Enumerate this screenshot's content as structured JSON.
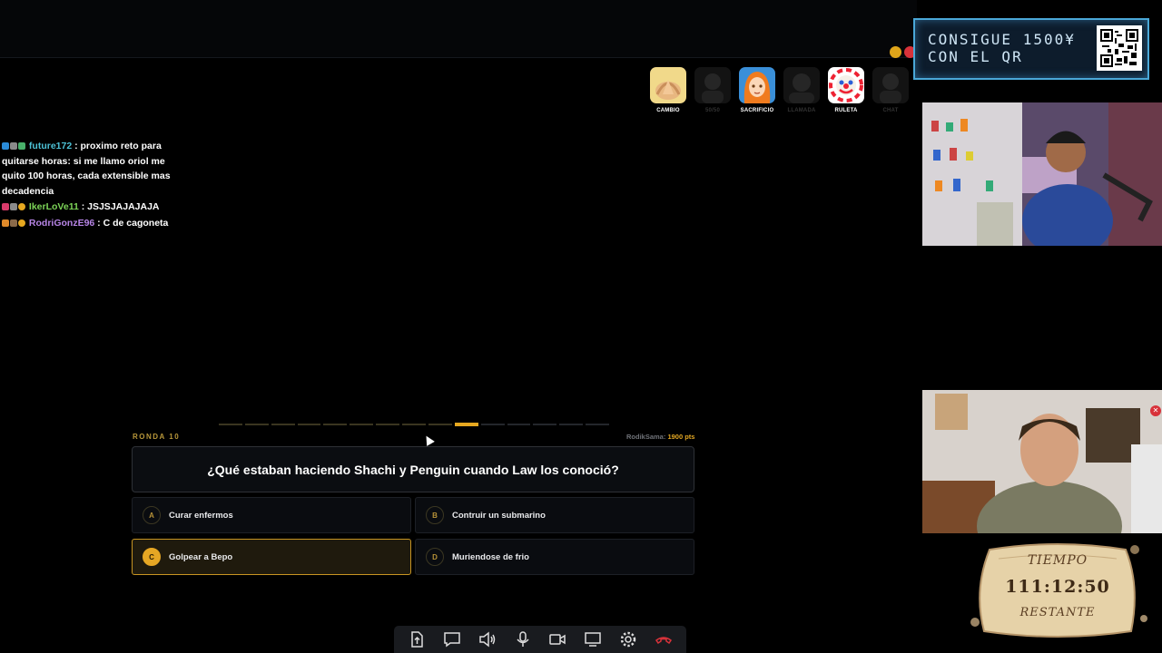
{
  "promo": {
    "line1": "CONSIGUE 1500¥",
    "line2": "CON EL QR"
  },
  "powerups": [
    {
      "label": "CAMBIO",
      "active": true,
      "icon": "praying-hands-icon"
    },
    {
      "label": "50/50",
      "active": false,
      "icon": "character-icon"
    },
    {
      "label": "SACRIFICIO",
      "active": true,
      "icon": "nami-icon"
    },
    {
      "label": "LLAMADA",
      "active": false,
      "icon": "character-icon"
    },
    {
      "label": "RULETA",
      "active": true,
      "icon": "clown-icon"
    },
    {
      "label": "CHAT",
      "active": false,
      "icon": "character-icon"
    }
  ],
  "chat": [
    {
      "user": "future172",
      "text": " : proximo reto para quitarse horas: si me llamo oriol me quito 100 horas, cada extensible mas decadencia",
      "color": "#4dc1d6"
    },
    {
      "user": "IkerLoVe11",
      "text": " : JSJSJAJAJAJA",
      "color": "#7cd357"
    },
    {
      "user": "RodriGonzE96",
      "text": " : C de cagoneta",
      "color": "#b785e6"
    }
  ],
  "quiz": {
    "round": "RONDA 10",
    "score_user": "RodikSama: ",
    "score_points": "1900 pts",
    "question": "¿Qué estaban haciendo Shachi y Penguin cuando Law los conoció?",
    "answers": [
      {
        "letter": "A",
        "text": "Curar enfermos",
        "selected": false
      },
      {
        "letter": "B",
        "text": "Contruir un submarino",
        "selected": false
      },
      {
        "letter": "C",
        "text": "Golpear a Bepo",
        "selected": true
      },
      {
        "letter": "D",
        "text": "Muriendose de frio",
        "selected": false
      }
    ],
    "progress": {
      "total_segments": 15,
      "current_segment": 10
    }
  },
  "timer": {
    "title": "TIEMPO",
    "value": "111:12:50",
    "footer": "RESTANTE"
  },
  "toolbar": {
    "buttons": [
      "share-file-icon",
      "chat-icon",
      "volume-icon",
      "microphone-icon",
      "camera-icon",
      "screen-share-icon",
      "settings-icon",
      "hang-up-icon"
    ]
  },
  "colors": {
    "accent": "#e5a624",
    "hangup": "#d8323a",
    "promo_border": "#4aa8d8"
  }
}
